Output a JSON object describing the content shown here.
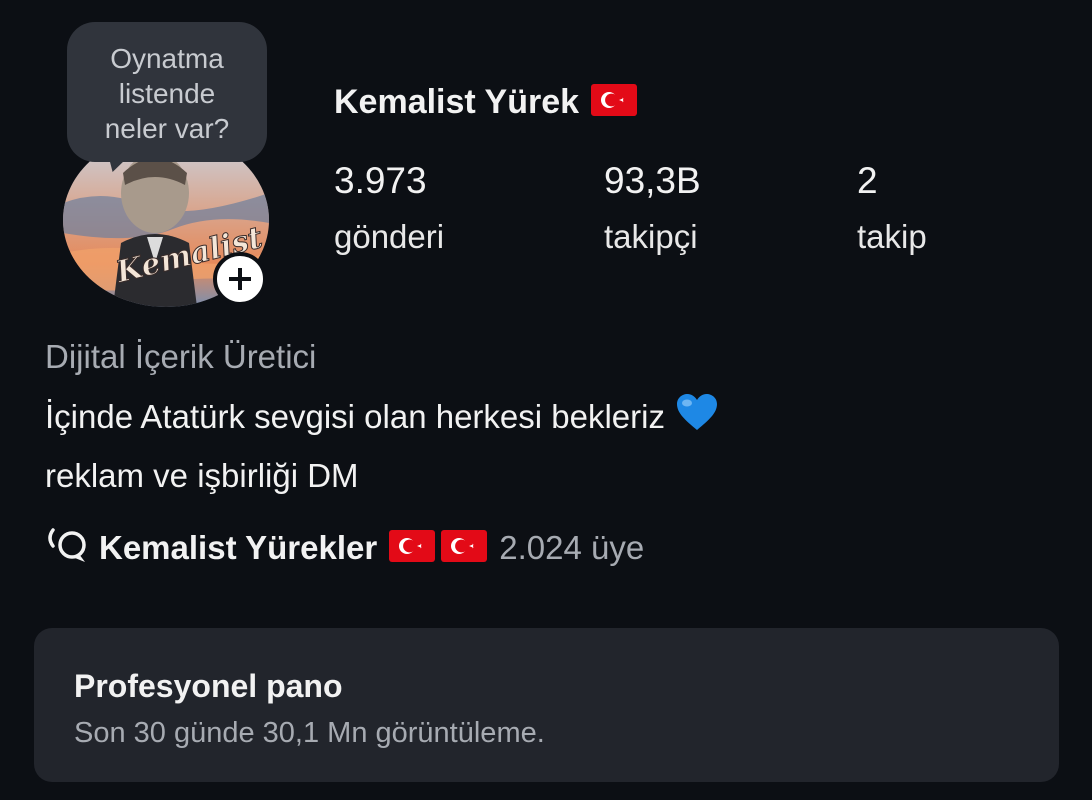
{
  "tooltip": {
    "lines": [
      "Oynatma",
      "listende",
      "neler var?"
    ]
  },
  "profile": {
    "username": "Kemalist Yürek",
    "avatar_label": "Kemalist Yürek",
    "stats": [
      {
        "value": "3.973",
        "label": "gönderi"
      },
      {
        "value": "93,3B",
        "label": "takipçi"
      },
      {
        "value": "2",
        "label": "takip"
      }
    ]
  },
  "bio": {
    "category": "Dijital İçerik Üretici",
    "lines": [
      "İçinde Atatürk sevgisi olan herkesi bekleriz",
      "reklam ve işbirliği DM"
    ]
  },
  "channel": {
    "name": "Kemalist Yürekler",
    "members": "2.024 üye"
  },
  "dashboard": {
    "title": "Profesyonel pano",
    "subtitle": "Son 30 günde 30,1 Mn görüntüleme."
  },
  "colors": {
    "background": "#0c0f14",
    "card": "#22252c",
    "secondary_text": "#a7abb2",
    "flag_red": "#e30a17",
    "heart_blue": "#1e88e5"
  },
  "icons": {
    "flag": "turkish-flag-icon",
    "heart": "blue-heart-icon",
    "channel": "broadcast-channel-icon",
    "add": "plus-icon"
  }
}
